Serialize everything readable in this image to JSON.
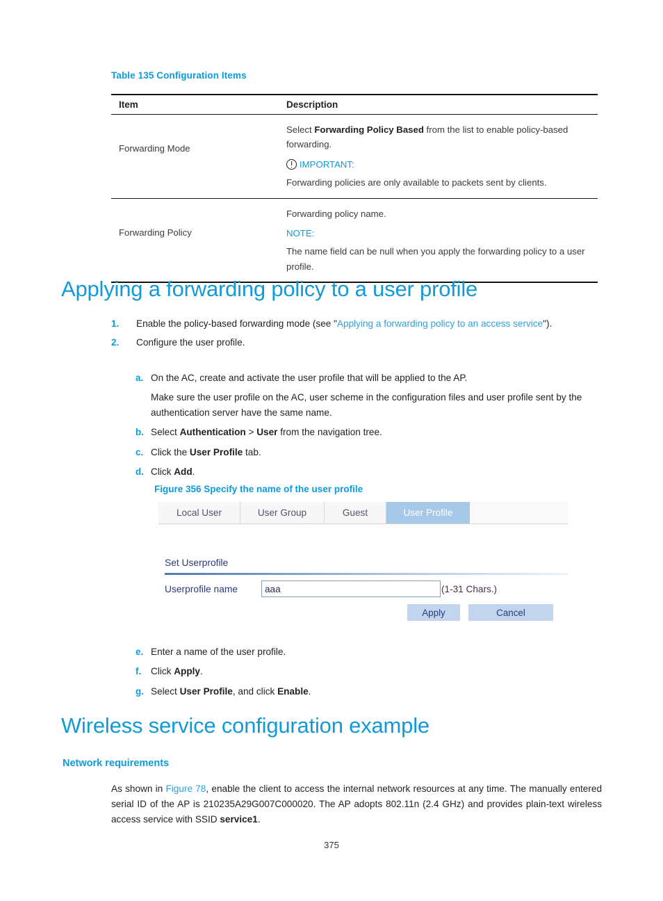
{
  "colors": {
    "accent_blue": "#0d9bd7",
    "heading_blue": "#129ad6",
    "link_blue": "#2f9fd8",
    "tab_active_bg": "#a8c8ea",
    "button_bg": "#c2d5ec",
    "form_text": "#2b3a7a"
  },
  "table": {
    "caption": "Table 135 Configuration Items",
    "headers": [
      "Item",
      "Description"
    ],
    "rows": [
      {
        "item": "Forwarding Mode",
        "desc_lead_1": "Select ",
        "desc_lead_bold": "Forwarding Policy Based",
        "desc_lead_2": " from the list to enable policy-based forwarding.",
        "admonition_label": "IMPORTANT:",
        "admonition_icon": "exclamation-circle-icon",
        "desc_tail": "Forwarding policies are only available to packets sent by clients."
      },
      {
        "item": "Forwarding Policy",
        "desc_lead": "Forwarding policy name.",
        "admonition_label": "NOTE:",
        "desc_tail": "The name field can be null when you apply the forwarding policy to a user profile."
      }
    ]
  },
  "section_applying": {
    "title": "Applying a forwarding policy to a user profile",
    "steps": [
      {
        "marker": "1.",
        "text_1": "Enable the policy-based forwarding mode (see \"",
        "link": "Applying a forwarding policy to an access service",
        "text_2": "\")."
      },
      {
        "marker": "2.",
        "text_1": "Configure the user profile."
      }
    ],
    "substeps": [
      {
        "marker": "a.",
        "text_1": "On the AC, create and activate the user profile that will be applied to the AP.",
        "para": "Make sure the user profile on the AC, user scheme in the configuration files and user profile sent by the authentication server have the same name."
      },
      {
        "marker": "b.",
        "text_1": "Select ",
        "bold_1": "Authentication",
        "text_2": " > ",
        "bold_2": "User",
        "text_3": " from the navigation tree."
      },
      {
        "marker": "c.",
        "text_1": "Click the ",
        "bold_1": "User Profile",
        "text_2": " tab."
      },
      {
        "marker": "d.",
        "text_1": "Click ",
        "bold_1": "Add",
        "text_2": "."
      }
    ],
    "substeps_2": [
      {
        "marker": "e.",
        "text_1": "Enter a name of the user profile."
      },
      {
        "marker": "f.",
        "text_1": "Click ",
        "bold_1": "Apply",
        "text_2": "."
      },
      {
        "marker": "g.",
        "text_1": "Select ",
        "bold_1": "User Profile",
        "text_2": ", and click ",
        "bold_2": "Enable",
        "text_3": "."
      }
    ]
  },
  "figure": {
    "caption": "Figure 356 Specify the name of the user profile",
    "tabs": [
      {
        "label": "Local User",
        "active": false
      },
      {
        "label": "User Group",
        "active": false
      },
      {
        "label": "Guest",
        "active": false
      },
      {
        "label": "User Profile",
        "active": true
      }
    ],
    "section_title": "Set Userprofile",
    "field": {
      "label": "Userprofile name",
      "value": "aaa",
      "placeholder": "",
      "hint": "(1-31 Chars.)"
    },
    "buttons": {
      "apply": "Apply",
      "cancel": "Cancel"
    }
  },
  "section_wireless": {
    "title": "Wireless service configuration example",
    "subtitle": "Network requirements",
    "paragraph": {
      "text_1": "As shown in ",
      "link": "Figure 78",
      "text_2": ", enable the client to access the internal network resources at any time. The manually entered serial ID of the AP is 210235A29G007C000020. The AP adopts 802.11n (2.4 GHz) and provides plain-text wireless access service with SSID ",
      "bold_1": "service1",
      "text_3": "."
    }
  },
  "footer": {
    "page_number": "375"
  }
}
